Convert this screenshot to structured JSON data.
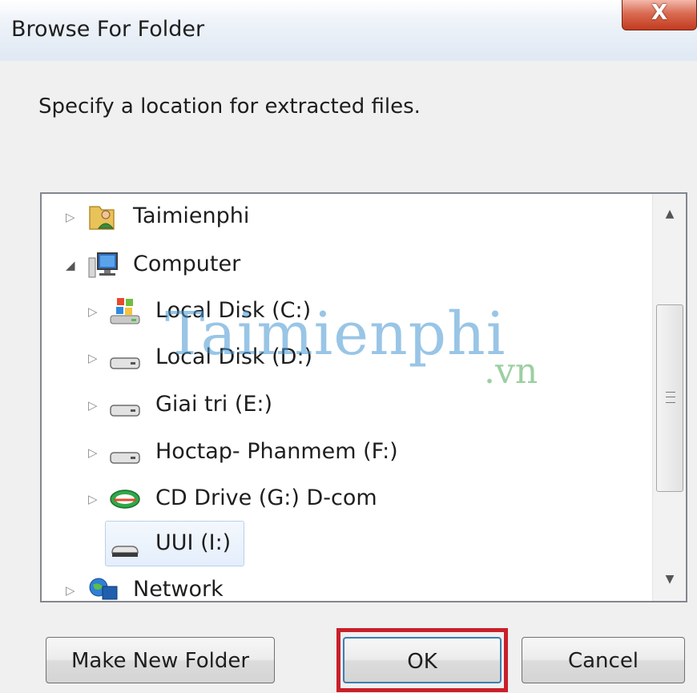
{
  "dialog": {
    "title": "Browse For Folder",
    "close_label": "X",
    "instruction": "Specify a location for extracted files."
  },
  "tree": {
    "items": [
      {
        "label": "Taimienphi",
        "icon": "user-folder-icon",
        "expander": "collapsed",
        "level": 0
      },
      {
        "label": "Computer",
        "icon": "computer-icon",
        "expander": "expanded",
        "level": 0
      },
      {
        "label": "Local Disk (C:)",
        "icon": "windows-drive-icon",
        "expander": "collapsed",
        "level": 1
      },
      {
        "label": "Local Disk (D:)",
        "icon": "hard-drive-icon",
        "expander": "collapsed",
        "level": 1
      },
      {
        "label": "Giai tri (E:)",
        "icon": "hard-drive-icon",
        "expander": "collapsed",
        "level": 1
      },
      {
        "label": "Hoctap- Phanmem (F:)",
        "icon": "hard-drive-icon",
        "expander": "collapsed",
        "level": 1
      },
      {
        "label": "CD Drive (G:) D-com",
        "icon": "cd-drive-icon",
        "expander": "collapsed",
        "level": 1
      },
      {
        "label": "UUI (I:)",
        "icon": "removable-drive-icon",
        "expander": "none",
        "level": 1,
        "selected": true
      },
      {
        "label": "Network",
        "icon": "network-icon",
        "expander": "collapsed",
        "level": 0
      }
    ]
  },
  "watermark": {
    "main": "Taimienphi",
    "sub": ".vn"
  },
  "buttons": {
    "make_new_folder": "Make New Folder",
    "ok": "OK",
    "cancel": "Cancel"
  },
  "colors": {
    "highlight": "#c8202a",
    "selection": "#e4eefb",
    "close_button": "#c23b1f"
  }
}
